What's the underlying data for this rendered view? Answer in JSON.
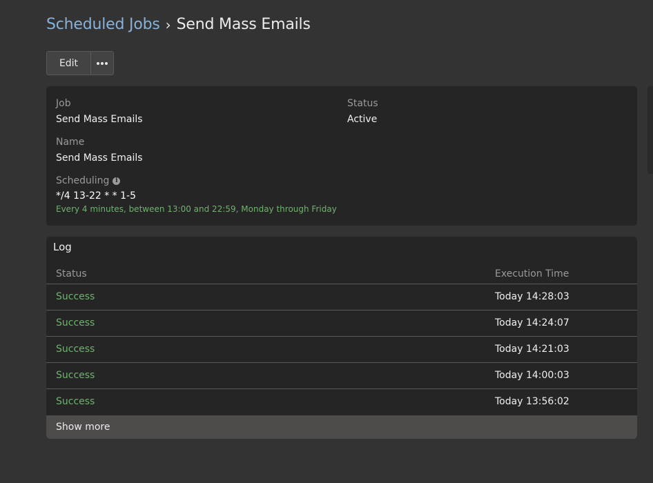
{
  "breadcrumb": {
    "parent": "Scheduled Jobs",
    "separator": "›",
    "current": "Send Mass Emails"
  },
  "toolbar": {
    "edit_label": "Edit",
    "more_icon": "more-horizontal-icon"
  },
  "details": {
    "job_label": "Job",
    "job_value": "Send Mass Emails",
    "status_label": "Status",
    "status_value": "Active",
    "name_label": "Name",
    "name_value": "Send Mass Emails",
    "scheduling_label": "Scheduling",
    "scheduling_icon": "info-icon",
    "cron": "*/4 13-22 * * 1-5",
    "cron_description": "Every 4 minutes, between 13:00 and 22:59, Monday through Friday"
  },
  "log": {
    "title": "Log",
    "columns": [
      "Status",
      "Execution Time"
    ],
    "rows": [
      {
        "status": "Success",
        "time": "Today 14:28:03"
      },
      {
        "status": "Success",
        "time": "Today 14:24:07"
      },
      {
        "status": "Success",
        "time": "Today 14:21:03"
      },
      {
        "status": "Success",
        "time": "Today 14:00:03"
      },
      {
        "status": "Success",
        "time": "Today 13:56:02"
      }
    ],
    "show_more": "Show more"
  },
  "colors": {
    "background": "#333333",
    "panel": "#252525",
    "link": "#88b2d7",
    "success": "#6fb26f"
  }
}
